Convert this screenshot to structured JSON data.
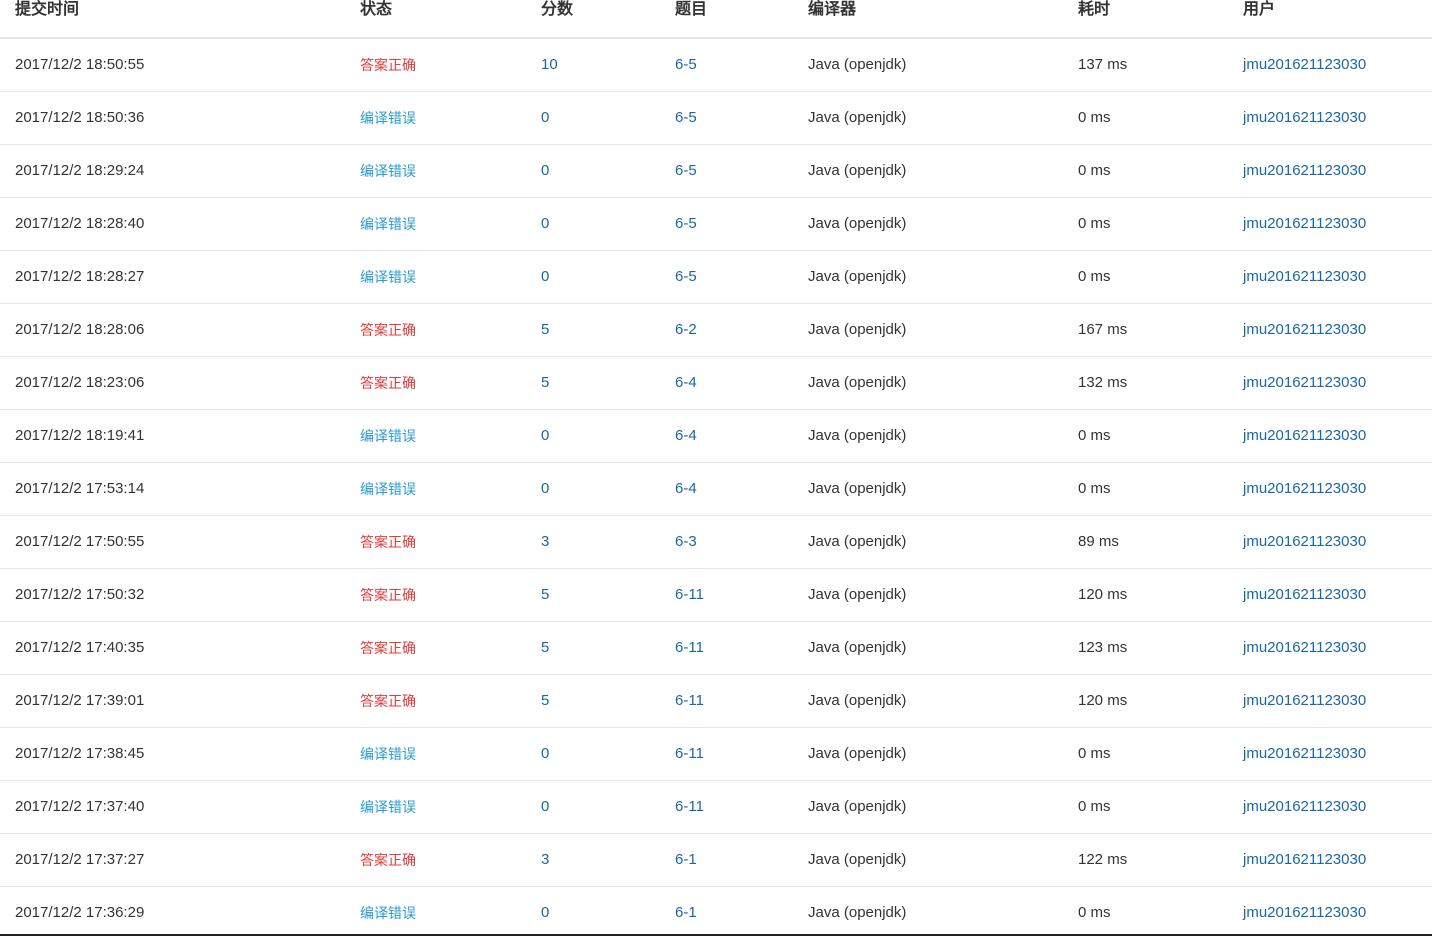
{
  "table": {
    "headers": {
      "time": "提交时间",
      "status": "状态",
      "score": "分数",
      "problem": "题目",
      "compiler": "编译器",
      "elapsed": "耗时",
      "user": "用户"
    },
    "rows": [
      {
        "time": "2017/12/2 18:50:55",
        "status": "答案正确",
        "status_type": "correct",
        "score": "10",
        "problem": "6-5",
        "compiler": "Java (openjdk)",
        "elapsed": "137 ms",
        "user": "jmu201621123030"
      },
      {
        "time": "2017/12/2 18:50:36",
        "status": "编译错误",
        "status_type": "compile",
        "score": "0",
        "problem": "6-5",
        "compiler": "Java (openjdk)",
        "elapsed": "0 ms",
        "user": "jmu201621123030"
      },
      {
        "time": "2017/12/2 18:29:24",
        "status": "编译错误",
        "status_type": "compile",
        "score": "0",
        "problem": "6-5",
        "compiler": "Java (openjdk)",
        "elapsed": "0 ms",
        "user": "jmu201621123030"
      },
      {
        "time": "2017/12/2 18:28:40",
        "status": "编译错误",
        "status_type": "compile",
        "score": "0",
        "problem": "6-5",
        "compiler": "Java (openjdk)",
        "elapsed": "0 ms",
        "user": "jmu201621123030"
      },
      {
        "time": "2017/12/2 18:28:27",
        "status": "编译错误",
        "status_type": "compile",
        "score": "0",
        "problem": "6-5",
        "compiler": "Java (openjdk)",
        "elapsed": "0 ms",
        "user": "jmu201621123030"
      },
      {
        "time": "2017/12/2 18:28:06",
        "status": "答案正确",
        "status_type": "correct",
        "score": "5",
        "problem": "6-2",
        "compiler": "Java (openjdk)",
        "elapsed": "167 ms",
        "user": "jmu201621123030"
      },
      {
        "time": "2017/12/2 18:23:06",
        "status": "答案正确",
        "status_type": "correct",
        "score": "5",
        "problem": "6-4",
        "compiler": "Java (openjdk)",
        "elapsed": "132 ms",
        "user": "jmu201621123030"
      },
      {
        "time": "2017/12/2 18:19:41",
        "status": "编译错误",
        "status_type": "compile",
        "score": "0",
        "problem": "6-4",
        "compiler": "Java (openjdk)",
        "elapsed": "0 ms",
        "user": "jmu201621123030"
      },
      {
        "time": "2017/12/2 17:53:14",
        "status": "编译错误",
        "status_type": "compile",
        "score": "0",
        "problem": "6-4",
        "compiler": "Java (openjdk)",
        "elapsed": "0 ms",
        "user": "jmu201621123030"
      },
      {
        "time": "2017/12/2 17:50:55",
        "status": "答案正确",
        "status_type": "correct",
        "score": "3",
        "problem": "6-3",
        "compiler": "Java (openjdk)",
        "elapsed": "89 ms",
        "user": "jmu201621123030"
      },
      {
        "time": "2017/12/2 17:50:32",
        "status": "答案正确",
        "status_type": "correct",
        "score": "5",
        "problem": "6-11",
        "compiler": "Java (openjdk)",
        "elapsed": "120 ms",
        "user": "jmu201621123030"
      },
      {
        "time": "2017/12/2 17:40:35",
        "status": "答案正确",
        "status_type": "correct",
        "score": "5",
        "problem": "6-11",
        "compiler": "Java (openjdk)",
        "elapsed": "123 ms",
        "user": "jmu201621123030"
      },
      {
        "time": "2017/12/2 17:39:01",
        "status": "答案正确",
        "status_type": "correct",
        "score": "5",
        "problem": "6-11",
        "compiler": "Java (openjdk)",
        "elapsed": "120 ms",
        "user": "jmu201621123030"
      },
      {
        "time": "2017/12/2 17:38:45",
        "status": "编译错误",
        "status_type": "compile",
        "score": "0",
        "problem": "6-11",
        "compiler": "Java (openjdk)",
        "elapsed": "0 ms",
        "user": "jmu201621123030"
      },
      {
        "time": "2017/12/2 17:37:40",
        "status": "编译错误",
        "status_type": "compile",
        "score": "0",
        "problem": "6-11",
        "compiler": "Java (openjdk)",
        "elapsed": "0 ms",
        "user": "jmu201621123030"
      },
      {
        "time": "2017/12/2 17:37:27",
        "status": "答案正确",
        "status_type": "correct",
        "score": "3",
        "problem": "6-1",
        "compiler": "Java (openjdk)",
        "elapsed": "122 ms",
        "user": "jmu201621123030"
      },
      {
        "time": "2017/12/2 17:36:29",
        "status": "编译错误",
        "status_type": "compile",
        "score": "0",
        "problem": "6-1",
        "compiler": "Java (openjdk)",
        "elapsed": "0 ms",
        "user": "jmu201621123030"
      }
    ]
  },
  "colors": {
    "correct": "#e03c3c",
    "compile_error": "#2a9bd1",
    "link": "#1a66a6"
  }
}
